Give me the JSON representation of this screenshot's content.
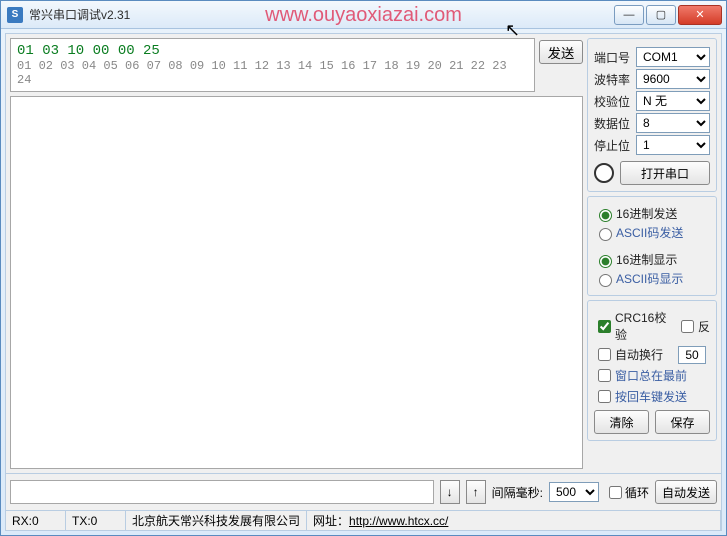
{
  "window": {
    "title": "常兴串口调试v2.31",
    "watermark": "www.ouyaoxiazai.com"
  },
  "send": {
    "command": "01 03 10 00 00 25",
    "ruler": "01 02 03 04 05 06 07 08 09 10 11 12 13 14 15 16 17 18 19 20 21 22 23 24",
    "send_btn": "发送"
  },
  "port": {
    "labels": {
      "port": "端口号",
      "baud": "波特率",
      "parity": "校验位",
      "data": "数据位",
      "stop": "停止位"
    },
    "values": {
      "port": "COM1",
      "baud": "9600",
      "parity": "N 无",
      "data": "8",
      "stop": "1"
    },
    "open_btn": "打开串口"
  },
  "mode": {
    "send_hex": "16进制发送",
    "send_ascii": "ASCII码发送",
    "disp_hex": "16进制显示",
    "disp_ascii": "ASCII码显示"
  },
  "opts": {
    "crc": "CRC16校验",
    "rev": "反",
    "autowrap": "自动换行",
    "autowrap_val": "50",
    "topmost": "窗口总在最前",
    "enter_send": "按回车键发送",
    "clear": "清除",
    "save": "保存"
  },
  "bottom": {
    "interval_lbl": "间隔毫秒:",
    "interval_val": "500",
    "loop": "循环",
    "auto_send": "自动发送"
  },
  "status": {
    "rx": "RX:0",
    "tx": "TX:0",
    "company": "北京航天常兴科技发展有限公司",
    "url_lbl": "网址：",
    "url": "http://www.htcx.cc/"
  }
}
